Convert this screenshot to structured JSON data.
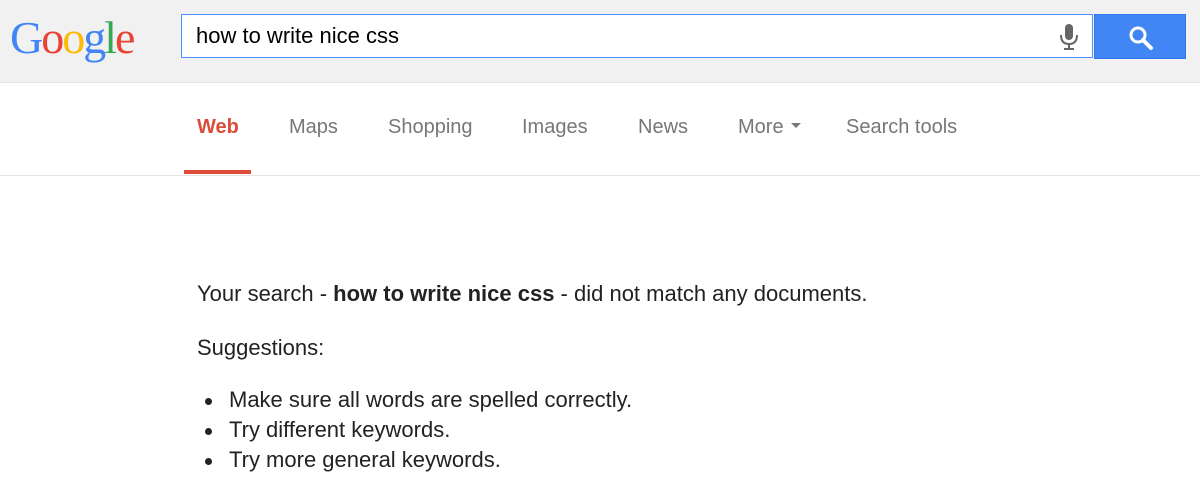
{
  "logo": {
    "letters": [
      "G",
      "o",
      "o",
      "g",
      "l",
      "e"
    ],
    "colors": [
      "#4285f4",
      "#ea4335",
      "#fbbc05",
      "#4285f4",
      "#34a853",
      "#ea4335"
    ]
  },
  "search": {
    "query": "how to write nice css",
    "mic_icon": "microphone-icon",
    "button_icon": "search-icon",
    "button_color": "#4285f4",
    "focus_border_color": "#4d90fe"
  },
  "tabs": {
    "active_color": "#dd4b39",
    "items": [
      {
        "label": "Web",
        "active": true
      },
      {
        "label": "Maps"
      },
      {
        "label": "Shopping"
      },
      {
        "label": "Images"
      },
      {
        "label": "News"
      },
      {
        "label": "More",
        "icon": "caret-down-icon"
      },
      {
        "label": "Search tools"
      }
    ]
  },
  "results": {
    "message_prefix": "Your search - ",
    "message_query": "how to write nice css",
    "message_suffix": " - did not match any documents.",
    "suggestions_title": "Suggestions:",
    "suggestions": [
      "Make sure all words are spelled correctly.",
      "Try different keywords.",
      "Try more general keywords."
    ]
  }
}
